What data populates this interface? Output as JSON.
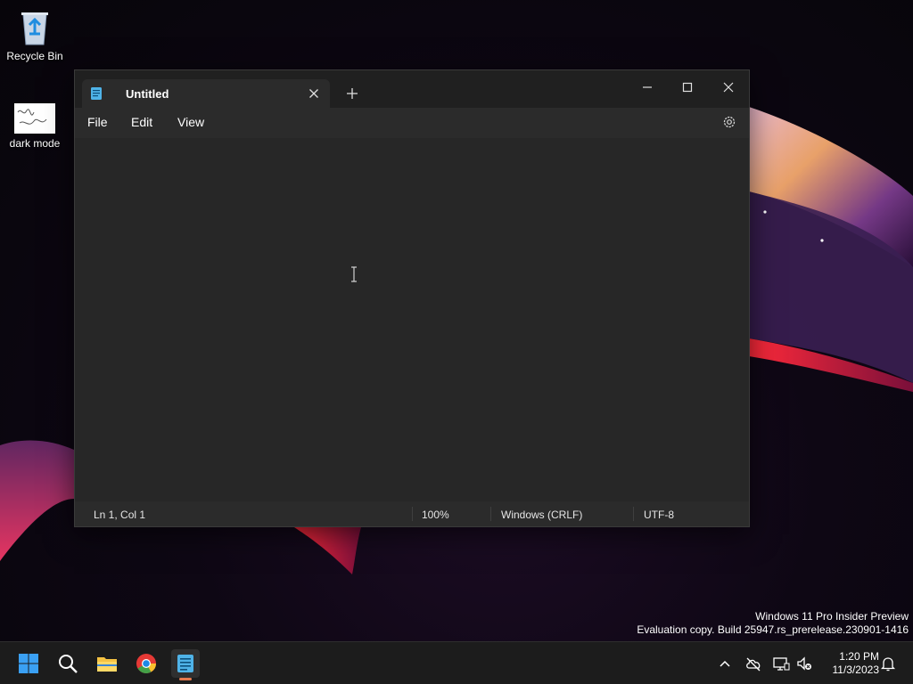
{
  "desktop": {
    "icons": [
      {
        "label": "Recycle Bin",
        "icon": "recycle-bin-icon"
      },
      {
        "label": "dark mode",
        "icon": "image-thumbnail"
      }
    ]
  },
  "notepad": {
    "tab_title": "Untitled",
    "menu": {
      "file": "File",
      "edit": "Edit",
      "view": "View"
    },
    "status": {
      "position": "Ln 1, Col 1",
      "zoom": "100%",
      "line_ending": "Windows (CRLF)",
      "encoding": "UTF-8"
    },
    "editor_text": ""
  },
  "watermark": {
    "line1": "Windows 11 Pro Insider Preview",
    "line2": "Evaluation copy. Build 25947.rs_prerelease.230901-1416"
  },
  "taskbar": {
    "apps": [
      "start-icon",
      "search-icon",
      "file-explorer-icon",
      "chrome-icon",
      "notepad-icon"
    ],
    "clock": {
      "time": "1:20 PM",
      "date": "11/3/2023"
    }
  },
  "colors": {
    "window_bg": "#272727",
    "titlebar_bg": "#202020",
    "taskbar_bg": "#1c1c1c",
    "active_indicator": "#e6794e"
  }
}
